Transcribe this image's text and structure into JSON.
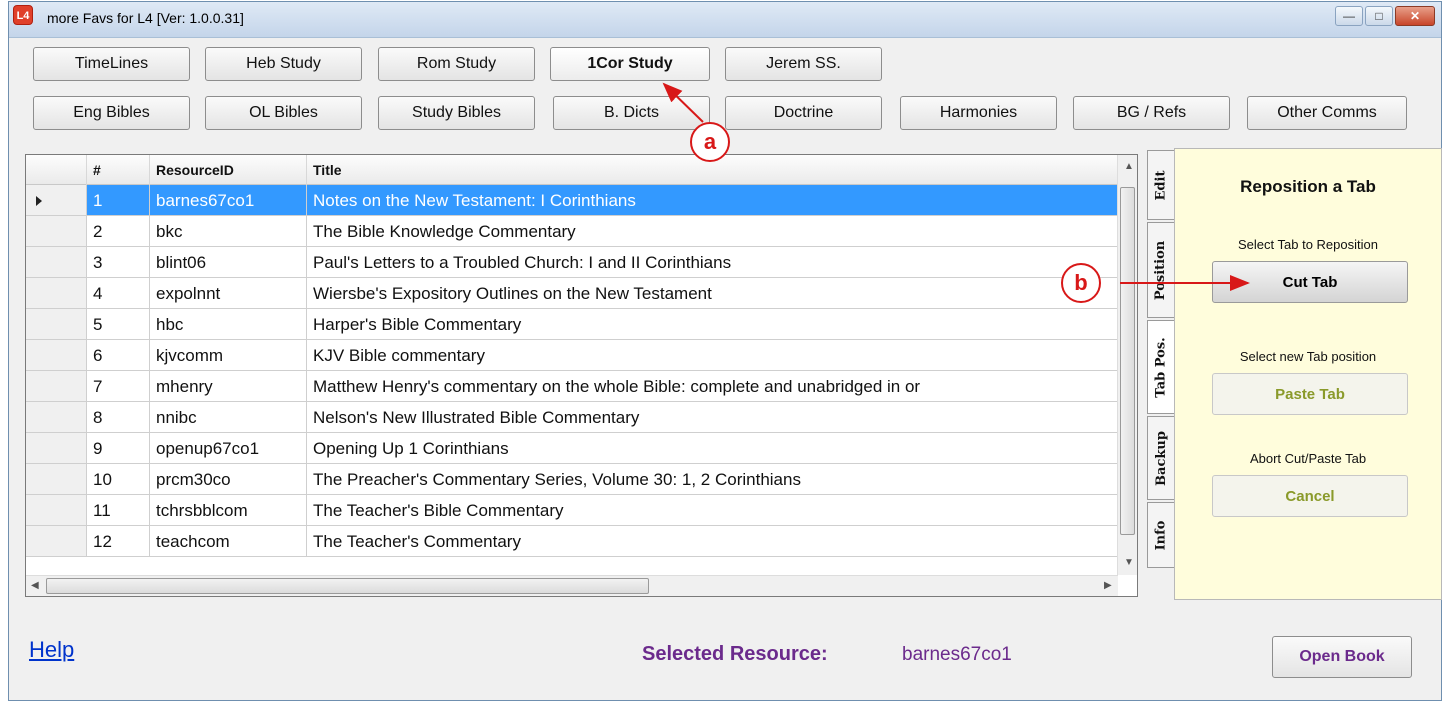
{
  "window": {
    "title": "more Favs for L4  [Ver: 1.0.0.31]",
    "app_icon": "L4",
    "controls": [
      "minimize",
      "maximize",
      "close"
    ]
  },
  "tab_row1": [
    "TimeLines",
    "Heb Study",
    "Rom Study",
    "1Cor Study",
    "Jerem SS."
  ],
  "tab_row2": [
    "Eng Bibles",
    "OL Bibles",
    "Study Bibles",
    "B. Dicts",
    "Doctrine",
    "Harmonies",
    "BG / Refs",
    "Other Comms"
  ],
  "active_tab": "1Cor Study",
  "grid": {
    "columns": [
      "#",
      "ResourceID",
      "Title"
    ],
    "rows": [
      {
        "id": "1",
        "resource": "barnes67co1",
        "title": "Notes on the New Testament: I Corinthians"
      },
      {
        "id": "2",
        "resource": "bkc",
        "title": "The Bible Knowledge Commentary"
      },
      {
        "id": "3",
        "resource": "blint06",
        "title": "Paul's Letters to a Troubled Church: I and II Corinthians"
      },
      {
        "id": "4",
        "resource": "expolnnt",
        "title": "Wiersbe's Expository Outlines on the New Testament"
      },
      {
        "id": "5",
        "resource": "hbc",
        "title": "Harper's Bible Commentary"
      },
      {
        "id": "6",
        "resource": "kjvcomm",
        "title": "KJV Bible commentary"
      },
      {
        "id": "7",
        "resource": "mhenry",
        "title": "Matthew Henry's commentary on the whole Bible: complete and unabridged in or"
      },
      {
        "id": "8",
        "resource": "nnibc",
        "title": "Nelson's New Illustrated Bible Commentary"
      },
      {
        "id": "9",
        "resource": "openup67co1",
        "title": "Opening Up 1 Corinthians"
      },
      {
        "id": "10",
        "resource": "prcm30co",
        "title": "The Preacher's Commentary Series, Volume 30: 1, 2 Corinthians"
      },
      {
        "id": "11",
        "resource": "tchrsbblcom",
        "title": "The Teacher's Bible Commentary"
      },
      {
        "id": "12",
        "resource": "teachcom",
        "title": "The Teacher's Commentary"
      }
    ],
    "selected_row": 0
  },
  "side_tabs": [
    "Edit",
    "Position",
    "Tab Pos.",
    "Backup",
    "Info"
  ],
  "panel": {
    "title": "Reposition a Tab",
    "label_cut": "Select Tab to Reposition",
    "cut_button": "Cut Tab",
    "label_paste": "Select new Tab position",
    "paste_button": "Paste Tab",
    "label_cancel": "Abort Cut/Paste Tab",
    "cancel_button": "Cancel"
  },
  "footer": {
    "help": "Help",
    "selected_label": "Selected Resource:",
    "selected_value": "barnes67co1",
    "open_button": "Open Book"
  },
  "annotations": {
    "a": "a",
    "b": "b"
  },
  "colors": {
    "selection": "#3399ff",
    "panel_bg": "#fffddc",
    "accent_purple": "#6b2a8c",
    "annotation_red": "#d81818",
    "link_blue": "#0033cc"
  }
}
